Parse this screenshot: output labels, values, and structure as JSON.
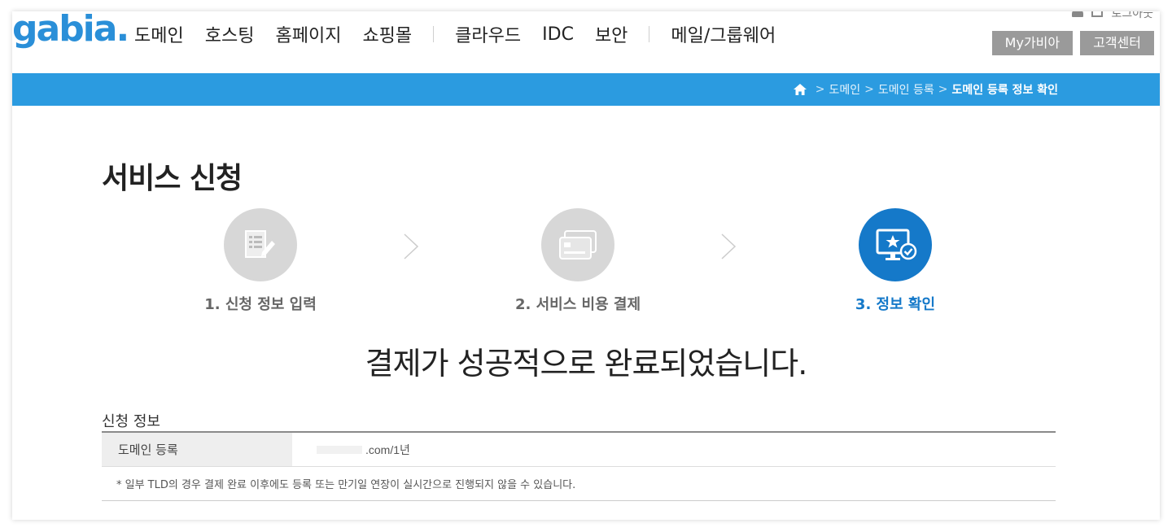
{
  "header": {
    "logo": "gabia.",
    "nav": [
      "도메인",
      "호스팅",
      "홈페이지",
      "쇼핑몰",
      "클라우드",
      "IDC",
      "보안",
      "메일/그룹웨어"
    ],
    "util_top_text": "로그아웃",
    "my_button": "My가비아",
    "support_button": "고객센터"
  },
  "breadcrumb": {
    "items": [
      "도메인",
      "도메인 등록"
    ],
    "current": "도메인 등록 정보 확인",
    "separator": ">"
  },
  "page": {
    "title": "서비스 신청",
    "steps": [
      {
        "label": "1. 신청 정보 입력",
        "icon": "form-edit-icon",
        "active": false
      },
      {
        "label": "2. 서비스 비용 결제",
        "icon": "credit-card-icon",
        "active": false
      },
      {
        "label": "3. 정보 확인",
        "icon": "monitor-check-icon",
        "active": true
      }
    ],
    "success_message": "결제가 성공적으로 완료되었습니다."
  },
  "info": {
    "section_title": "신청 정보",
    "row_label": "도메인 등록",
    "row_value": ".com/1년",
    "note": "* 일부 TLD의 경우 결제 완료 이후에도 등록 또는 만기일 연장이 실시간으로 진행되지 않을 수 있습니다."
  },
  "colors": {
    "brand_blue": "#2b9be0",
    "step_active": "#1579c9",
    "step_inactive": "#d7d7d7",
    "button_gray": "#9a9a9a"
  }
}
